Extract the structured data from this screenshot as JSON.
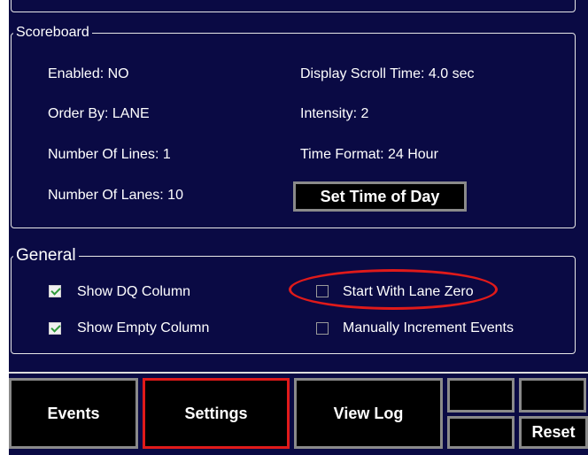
{
  "scoreboard": {
    "title": "Scoreboard",
    "enabled": "Enabled: NO",
    "order_by": "Order By: LANE",
    "number_of_lines": "Number Of Lines: 1",
    "number_of_lanes": "Number Of Lanes: 10",
    "display_scroll_time": "Display Scroll Time: 4.0 sec",
    "intensity": "Intensity: 2",
    "time_format": "Time Format: 24 Hour",
    "set_time_button": "Set Time of Day"
  },
  "general": {
    "title": "General",
    "options": [
      {
        "label": "Show DQ Column",
        "checked": true
      },
      {
        "label": "Show Empty Column",
        "checked": true
      },
      {
        "label": "Start With Lane Zero",
        "checked": false
      },
      {
        "label": "Manually Increment Events",
        "checked": false
      }
    ]
  },
  "tabs": {
    "events": "Events",
    "settings": "Settings",
    "view_log": "View Log",
    "reset": "Reset",
    "active": "Settings"
  },
  "colors": {
    "background": "#0a0a44",
    "highlight": "#e01a1a",
    "check": "#2f9a3a"
  }
}
